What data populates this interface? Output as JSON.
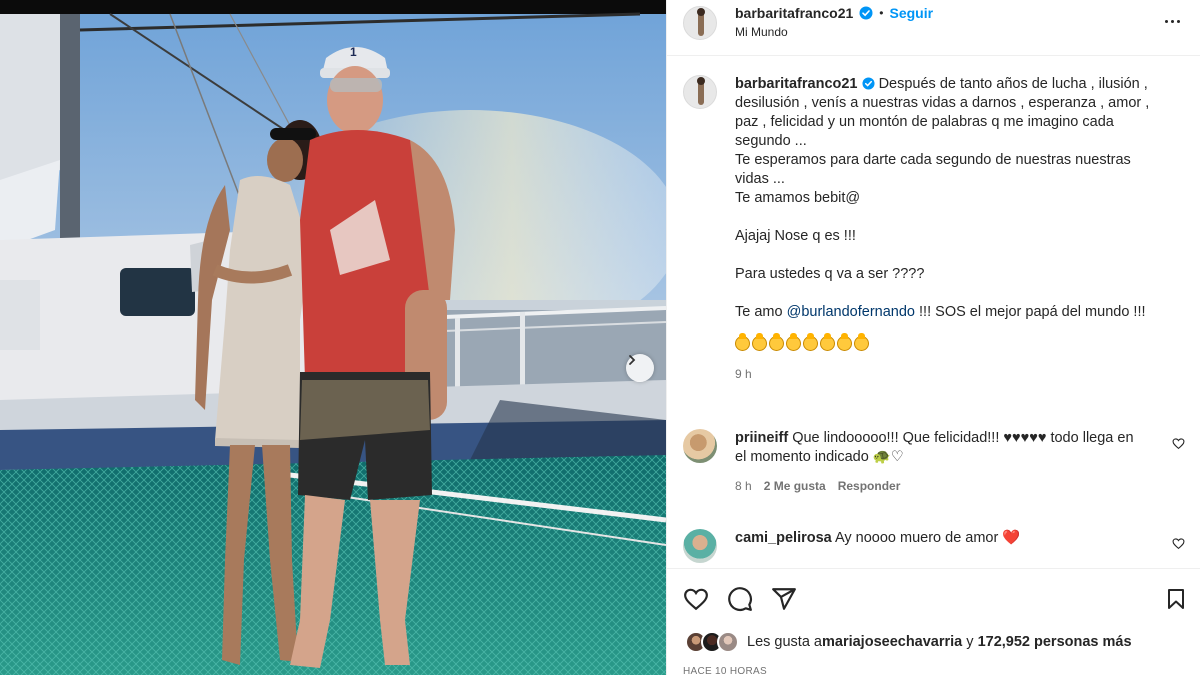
{
  "post": {
    "username": "barbaritafranco21",
    "location": "Mi Mundo",
    "follow_label": "Seguir",
    "separator": "•"
  },
  "caption": {
    "username": "barbaritafranco21",
    "lines": [
      "Después de tanto años de lucha , ilusión ,",
      "desilusión , venís a nuestras vidas a darnos , esperanza , amor ,",
      "paz , felicidad y un montón de palabras q me imagino cada",
      "segundo ...",
      "Te esperamos para darte cada segundo de nuestras nuestras",
      "vidas ...",
      "Te amamos bebit@",
      "",
      "Ajajaj Nose q es !!!",
      "",
      "Para ustedes q va a ser ????",
      ""
    ],
    "mention_prefix": "Te amo ",
    "mention": "@burlandofernando",
    "mention_suffix": " !!! SOS el mejor papá del mundo !!!",
    "emoji_count": 8,
    "time": "9 h"
  },
  "comments": [
    {
      "username": "priineiff",
      "text": " Que lindooooo!!! Que felicidad!!! ♥♥♥♥♥ todo llega en el momento indicado 🐢♡",
      "time": "8 h",
      "likes": "2 Me gusta",
      "reply": "Responder"
    },
    {
      "username": "cami_pelirosa",
      "text": " Ay noooo muero de amor ❤️"
    }
  ],
  "likes": {
    "prefix": "Les gusta a ",
    "user": "mariajoseechavarria",
    "connector": " y ",
    "count": "172,952 personas más"
  },
  "posted_ago": "HACE 10 HORAS",
  "colors": {
    "accent": "#0095f6",
    "verified": "#0095f6",
    "heart_red": "#ed1c24",
    "mention": "#00376b"
  },
  "icons": [
    "verified-icon",
    "more-options-icon",
    "carousel-next-icon",
    "heart-icon",
    "comment-icon",
    "share-icon",
    "bookmark-icon"
  ]
}
